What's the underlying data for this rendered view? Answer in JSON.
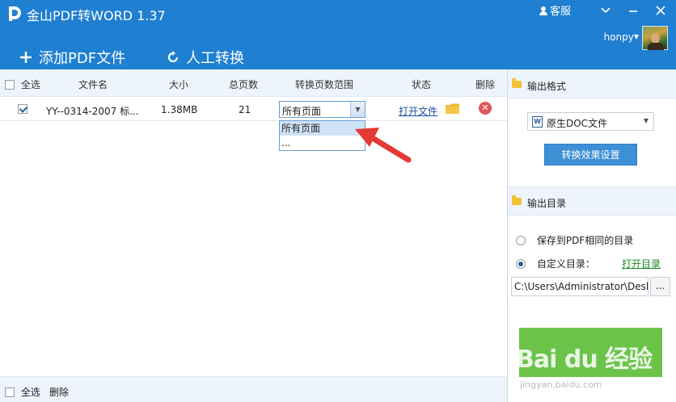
{
  "app": {
    "title": "金山PDF转WORD 1.37",
    "kefu": "客服",
    "user": "honpy"
  },
  "toolbar": {
    "add_pdf": "添加PDF文件",
    "manual": "人工转换"
  },
  "table": {
    "headers": {
      "select_all": "全选",
      "filename": "文件名",
      "size": "大小",
      "pages": "总页数",
      "range": "转换页数范围",
      "status": "状态",
      "delete": "删除"
    },
    "rows": [
      {
        "filename": "YY--0314-2007 标...",
        "size": "1.38MB",
        "pages": "21",
        "range": "所有页面",
        "status_link": "打开文件",
        "checked": true
      }
    ],
    "dropdown_options": [
      "所有页面",
      "..."
    ]
  },
  "bottom": {
    "select_all": "全选",
    "delete": "删除"
  },
  "side": {
    "output_format_title": "输出格式",
    "format_value": "原生DOC文件",
    "format_icon": "W",
    "convert_settings": "转换效果设置",
    "output_dir_title": "输出目录",
    "option_same": "保存到PDF相同的目录",
    "option_custom": "自定义目录：",
    "open_dir": "打开目录",
    "path": "C:\\Users\\Administrator\\Desl",
    "browse": "..."
  },
  "watermark": {
    "main": "Bai du 经验",
    "sub": "jingyan.baidu.com"
  },
  "colors": {
    "header": "#1f7fd1",
    "accent": "#3d8fd6",
    "start": "#6cc34a",
    "link_green": "#1a8a22"
  }
}
